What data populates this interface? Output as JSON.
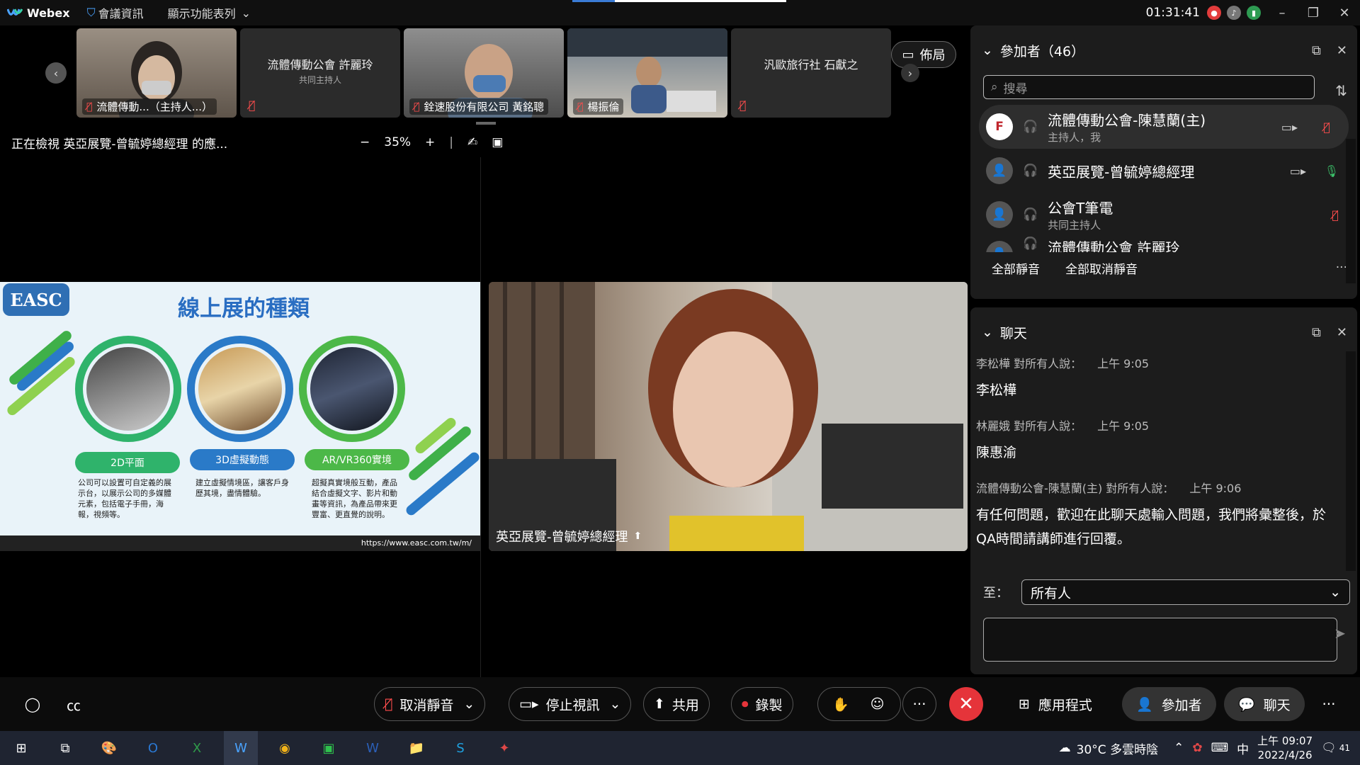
{
  "topbar": {
    "app_name": "Webex",
    "meeting_info": "會議資訊",
    "show_menu": "顯示功能表列",
    "timer": "01:31:41"
  },
  "strip": {
    "tiles": [
      {
        "name": "流體傳動...（主持人...）",
        "type": "video"
      },
      {
        "name": "流體傳動公會 許麗玲",
        "sub": "共同主持人",
        "type": "name"
      },
      {
        "name": "銓速股份有限公司 黃銘聰",
        "type": "video"
      },
      {
        "name": "楊振倫",
        "type": "video"
      },
      {
        "name": "汎歐旅行社 石獻之",
        "type": "name"
      }
    ],
    "layout_label": "佈局"
  },
  "view": {
    "viewing_text": "正在檢視 英亞展覽-曾毓婷總經理 的應...",
    "zoom": "35%"
  },
  "slide": {
    "logo": "EASC",
    "title": "線上展的種類",
    "items": [
      {
        "label": "2D平面",
        "desc": "公司可以設置可自定義的展示台，以展示公司的多媒體元素，包括電子手冊，海報，視頻等。",
        "color": "#2fb36b"
      },
      {
        "label": "3D虛擬動態",
        "desc": "建立虛擬情境區，讓客戶身歷其境，盡情體驗。",
        "color": "#2a7ac8"
      },
      {
        "label": "AR/VR360實境",
        "desc": "超擬真實境般互動，產品結合虛擬文字、影片和動畫等資訊，為產品帶來更豐富、更直覺的說明。",
        "color": "#4cb848"
      }
    ],
    "footer_url": "https://www.easc.com.tw/m/"
  },
  "camera": {
    "name": "英亞展覽-曾毓婷總經理"
  },
  "participants": {
    "header": "參加者（46）",
    "search_placeholder": "搜尋",
    "list": [
      {
        "name": "流體傳動公會-陳慧蘭(主)",
        "sub": "主持人，我",
        "mic": "muted",
        "video": true
      },
      {
        "name": "英亞展覽-曾毓婷總經理",
        "sub": "",
        "mic": "on",
        "video": true
      },
      {
        "name": "公會T筆電",
        "sub": "共同主持人",
        "mic": "muted",
        "video": false
      },
      {
        "name": "流體傳動公會 許麗玲",
        "sub": "",
        "mic": "muted",
        "video": false
      }
    ],
    "mute_all": "全部靜音",
    "unmute_all": "全部取消靜音"
  },
  "chat": {
    "header": "聊天",
    "messages": [
      {
        "sender": "李松樺 對所有人說：",
        "time": "上午 9:05",
        "body": "李松樺"
      },
      {
        "sender": "林麗娥 對所有人說：",
        "time": "上午 9:05",
        "body": "陳惠渝"
      },
      {
        "sender": "流體傳動公會-陳慧蘭(主) 對所有人說：",
        "time": "上午 9:06",
        "body": "有任何問題，歡迎在此聊天處輸入問題，我們將彙整後，於QA時間請講師進行回覆。"
      }
    ],
    "to_label": "至：",
    "to_value": "所有人"
  },
  "controls": {
    "unmute": "取消靜音",
    "stop_video": "停止視訊",
    "share": "共用",
    "record": "錄製",
    "apps": "應用程式",
    "participants": "參加者",
    "chat": "聊天"
  },
  "taskbar": {
    "weather": "30°C 多雲時陰",
    "ime": "中",
    "time": "上午 09:07",
    "date": "2022/4/26",
    "notif_count": "41"
  }
}
